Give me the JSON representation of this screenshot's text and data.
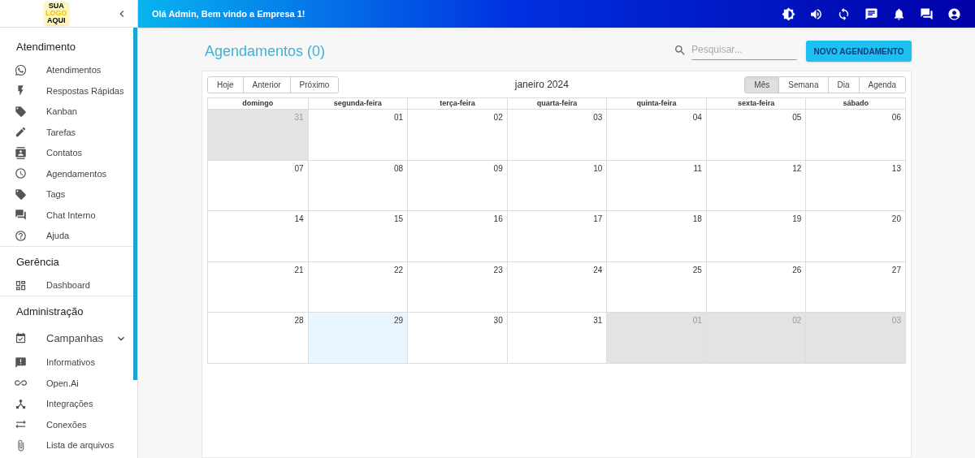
{
  "logo": [
    "SUA",
    "LOGO",
    "AQUI"
  ],
  "header": {
    "greeting": "Olá Admin, Bem vindo a Empresa 1!"
  },
  "sidebar": {
    "sections": [
      {
        "title": "Atendimento",
        "items": [
          {
            "label": "Atendimentos"
          },
          {
            "label": "Respostas Rápidas"
          },
          {
            "label": "Kanban"
          },
          {
            "label": "Tarefas"
          },
          {
            "label": "Contatos"
          },
          {
            "label": "Agendamentos"
          },
          {
            "label": "Tags"
          },
          {
            "label": "Chat Interno"
          },
          {
            "label": "Ajuda"
          }
        ]
      },
      {
        "title": "Gerência",
        "items": [
          {
            "label": "Dashboard"
          }
        ]
      },
      {
        "title": "Administração",
        "items": [
          {
            "label": "Campanhas",
            "expanded": false
          },
          {
            "label": "Informativos"
          },
          {
            "label": "Open.Ai"
          },
          {
            "label": "Integrações"
          },
          {
            "label": "Conexões"
          },
          {
            "label": "Lista de arquivos"
          }
        ]
      }
    ]
  },
  "page": {
    "title": "Agendamentos (0)",
    "search": {
      "placeholder": "Pesquisar..."
    },
    "new_button": "NOVO AGENDAMENTO"
  },
  "calendar": {
    "nav": [
      "Hoje",
      "Anterior",
      "Próximo"
    ],
    "month": "janeiro 2024",
    "views": [
      {
        "label": "Mês",
        "selected": true
      },
      {
        "label": "Semana",
        "selected": false
      },
      {
        "label": "Dia",
        "selected": false
      },
      {
        "label": "Agenda",
        "selected": false
      }
    ],
    "weekdays": [
      "domingo",
      "segunda-feira",
      "terça-feira",
      "quarta-feira",
      "quinta-feira",
      "sexta-feira",
      "sábado"
    ],
    "weeks": [
      [
        {
          "day": "31",
          "outside": true,
          "today": false
        },
        {
          "day": "01",
          "outside": false,
          "today": false
        },
        {
          "day": "02",
          "outside": false,
          "today": false
        },
        {
          "day": "03",
          "outside": false,
          "today": false
        },
        {
          "day": "04",
          "outside": false,
          "today": false
        },
        {
          "day": "05",
          "outside": false,
          "today": false
        },
        {
          "day": "06",
          "outside": false,
          "today": false
        }
      ],
      [
        {
          "day": "07",
          "outside": false,
          "today": false
        },
        {
          "day": "08",
          "outside": false,
          "today": false
        },
        {
          "day": "09",
          "outside": false,
          "today": false
        },
        {
          "day": "10",
          "outside": false,
          "today": false
        },
        {
          "day": "11",
          "outside": false,
          "today": false
        },
        {
          "day": "12",
          "outside": false,
          "today": false
        },
        {
          "day": "13",
          "outside": false,
          "today": false
        }
      ],
      [
        {
          "day": "14",
          "outside": false,
          "today": false
        },
        {
          "day": "15",
          "outside": false,
          "today": false
        },
        {
          "day": "16",
          "outside": false,
          "today": false
        },
        {
          "day": "17",
          "outside": false,
          "today": false
        },
        {
          "day": "18",
          "outside": false,
          "today": false
        },
        {
          "day": "19",
          "outside": false,
          "today": false
        },
        {
          "day": "20",
          "outside": false,
          "today": false
        }
      ],
      [
        {
          "day": "21",
          "outside": false,
          "today": false
        },
        {
          "day": "22",
          "outside": false,
          "today": false
        },
        {
          "day": "23",
          "outside": false,
          "today": false
        },
        {
          "day": "24",
          "outside": false,
          "today": false
        },
        {
          "day": "25",
          "outside": false,
          "today": false
        },
        {
          "day": "26",
          "outside": false,
          "today": false
        },
        {
          "day": "27",
          "outside": false,
          "today": false
        }
      ],
      [
        {
          "day": "28",
          "outside": false,
          "today": false
        },
        {
          "day": "29",
          "outside": false,
          "today": true
        },
        {
          "day": "30",
          "outside": false,
          "today": false
        },
        {
          "day": "31",
          "outside": false,
          "today": false
        },
        {
          "day": "01",
          "outside": true,
          "today": false
        },
        {
          "day": "02",
          "outside": true,
          "today": false
        },
        {
          "day": "03",
          "outside": true,
          "today": false
        }
      ]
    ]
  }
}
